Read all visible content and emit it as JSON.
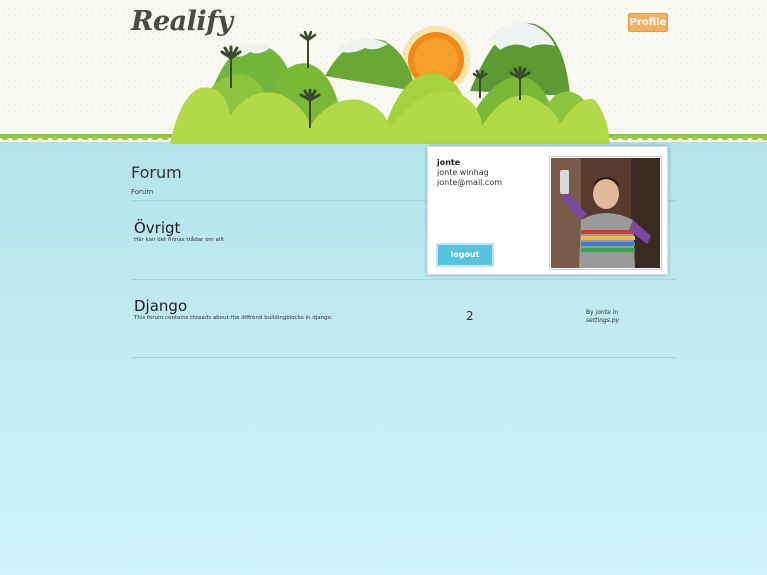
{
  "header": {
    "logo_text": "Realify",
    "profile_label": "Profile"
  },
  "page": {
    "title": "Forum",
    "breadcrumb": "Forum"
  },
  "forums": [
    {
      "name": "Övrigt",
      "description": "Här kan det finnas trådar om allt",
      "threads": "",
      "last_post": ""
    },
    {
      "name": "Django",
      "description": "This forum contains threads about the diffrend buildingblocks in django.",
      "threads": "2",
      "last_post_by": "By ",
      "last_post_author": "jonte",
      "last_post_in": " in",
      "last_post_thread": "settings.py"
    }
  ],
  "user_popup": {
    "username": "jonte",
    "full_name": "jonte winhag",
    "email": "jonte@mail.com",
    "logout_label": "logout"
  },
  "colors": {
    "accent_blue": "#57c4df",
    "profile_orange": "#f5b060",
    "grass_green": "#9ccc3d"
  }
}
